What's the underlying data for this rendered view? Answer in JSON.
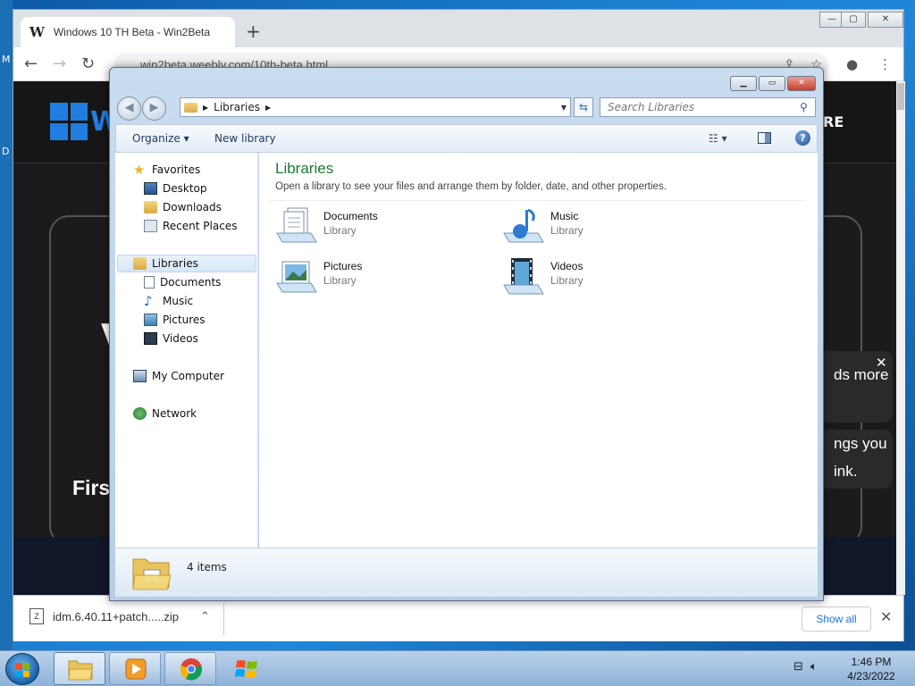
{
  "desktop": {
    "edge_letter_top": "M",
    "edge_letter_mid": "D"
  },
  "browser": {
    "tab_title": "Windows 10 TH Beta - Win2Beta",
    "tab_favicon": "W",
    "url": "win2beta.weebly.com/10th-beta.html",
    "window_controls": {
      "minimize": "—",
      "restore": "▢",
      "close": "✕"
    }
  },
  "page": {
    "logo_letter": "W",
    "header_right": "RE",
    "big_letter": "V",
    "first_text": "Firs",
    "toast1_text": "ds more",
    "toast2_line1": "ngs you",
    "toast2_line2": "ink.",
    "toast_close": "✕"
  },
  "downloads": {
    "file_name": "idm.6.40.11+patch.....zip",
    "show_all": "Show all",
    "close": "✕"
  },
  "explorer": {
    "address_crumb": "Libraries",
    "search_placeholder": "Search Libraries",
    "commands": {
      "organize": "Organize ▾",
      "new_library": "New library"
    },
    "nav": {
      "favorites": "Favorites",
      "desktop": "Desktop",
      "downloads": "Downloads",
      "recent": "Recent Places",
      "libraries": "Libraries",
      "documents": "Documents",
      "music": "Music",
      "pictures": "Pictures",
      "videos": "Videos",
      "computer": "My Computer",
      "network": "Network"
    },
    "heading": "Libraries",
    "subheading": "Open a library to see your files and arrange them by folder, date, and other properties.",
    "items": [
      {
        "name": "Documents",
        "type": "Library"
      },
      {
        "name": "Music",
        "type": "Library"
      },
      {
        "name": "Pictures",
        "type": "Library"
      },
      {
        "name": "Videos",
        "type": "Library"
      }
    ],
    "status": "4 items"
  },
  "taskbar": {
    "time": "1:46 PM",
    "date": "4/23/2022"
  }
}
